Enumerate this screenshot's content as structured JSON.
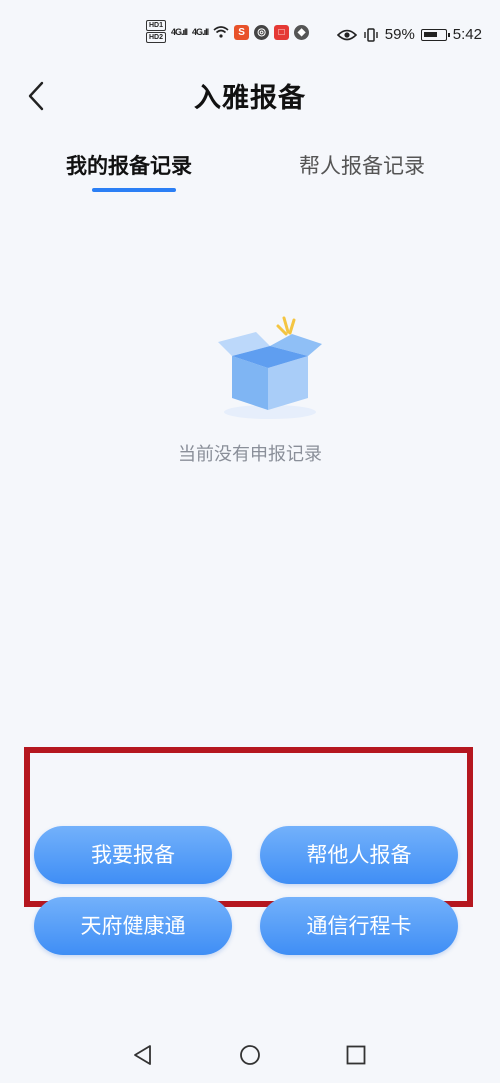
{
  "status_bar": {
    "network_1": "4G",
    "network_2": "4G",
    "battery_percent": "59%",
    "time": "5:42",
    "icons": [
      "hd-icon",
      "signal-icon",
      "wifi-icon",
      "app-notification-icon",
      "eye-icon",
      "vibrate-icon",
      "battery-icon"
    ]
  },
  "header": {
    "title": "入雅报备",
    "back_icon": "chevron-left-icon"
  },
  "tabs": [
    {
      "label": "我的报备记录",
      "active": true
    },
    {
      "label": "帮人报备记录",
      "active": false
    }
  ],
  "empty_state": {
    "icon": "empty-box-icon",
    "message": "当前没有申报记录"
  },
  "actions": {
    "report_self": "我要报备",
    "report_others": "帮他人报备",
    "tianfu_health": "天府健康通",
    "trip_card": "通信行程卡"
  },
  "colors": {
    "accent": "#2b7ff5",
    "button_gradient_top": "#73b1fb",
    "button_gradient_bottom": "#3f8ef5",
    "highlight_box": "#b5171f"
  },
  "nav_bar": {
    "icons": [
      "back-triangle-icon",
      "home-circle-icon",
      "recent-square-icon"
    ]
  }
}
